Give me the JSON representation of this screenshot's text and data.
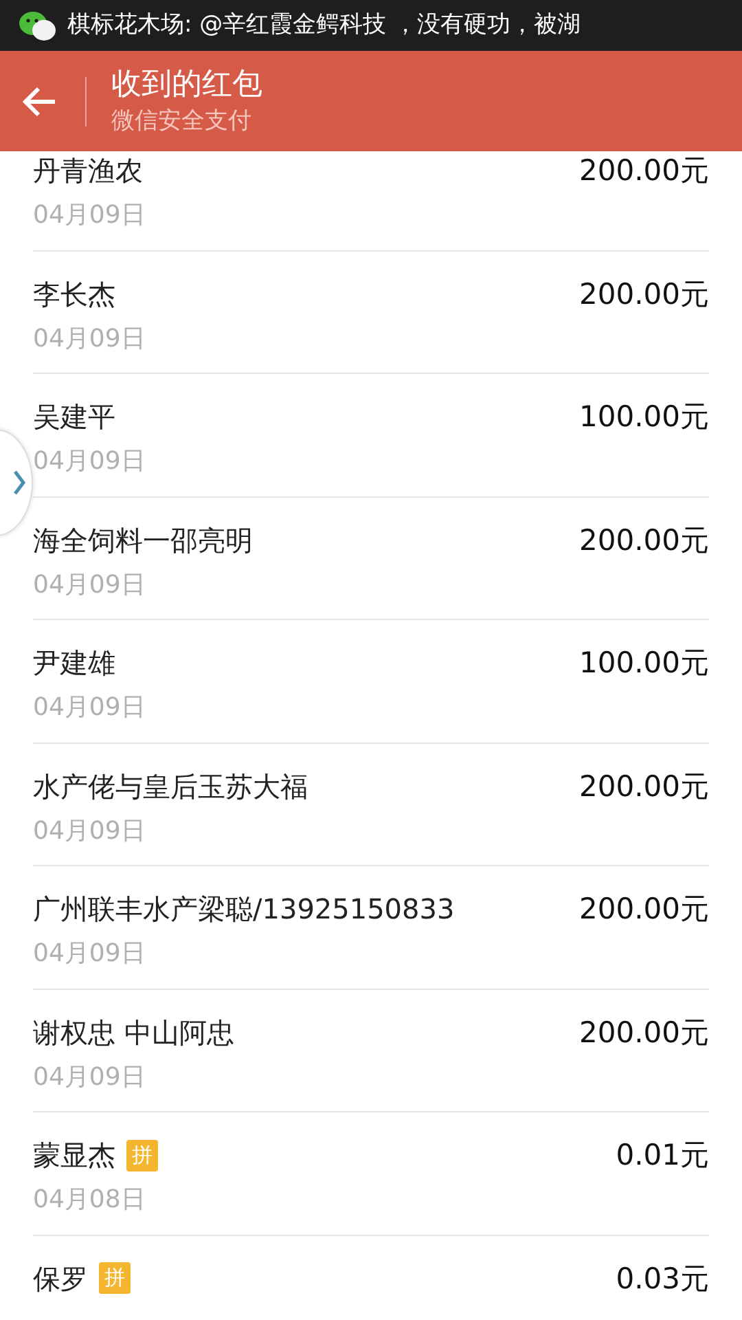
{
  "status_bar": {
    "notification": "棋标花木场: @辛红霞金鳄科技 ，没有硬功，被湖"
  },
  "header": {
    "title": "收到的红包",
    "subtitle": "微信安全支付"
  },
  "records": [
    {
      "name": "丹青渔农",
      "date": "04月09日",
      "amount": "200.00元"
    },
    {
      "name": "李长杰",
      "date": "04月09日",
      "amount": "200.00元"
    },
    {
      "name": "吴建平",
      "date": "04月09日",
      "amount": "100.00元"
    },
    {
      "name": "海全饲料一邵亮明",
      "date": "04月09日",
      "amount": "200.00元"
    },
    {
      "name": "尹建雄",
      "date": "04月09日",
      "amount": "100.00元"
    },
    {
      "name": "水产佬与皇后玉苏大福",
      "date": "04月09日",
      "amount": "200.00元"
    },
    {
      "name": "广州联丰水产梁聪/13925150833",
      "date": "04月09日",
      "amount": "200.00元"
    },
    {
      "name": "谢权忠  中山阿忠",
      "date": "04月09日",
      "amount": "200.00元"
    },
    {
      "name": "蒙显杰",
      "badge": "拼",
      "date": "04月08日",
      "amount": "0.01元"
    },
    {
      "name": "保罗",
      "badge": "拼",
      "amount": "0.03元"
    }
  ]
}
